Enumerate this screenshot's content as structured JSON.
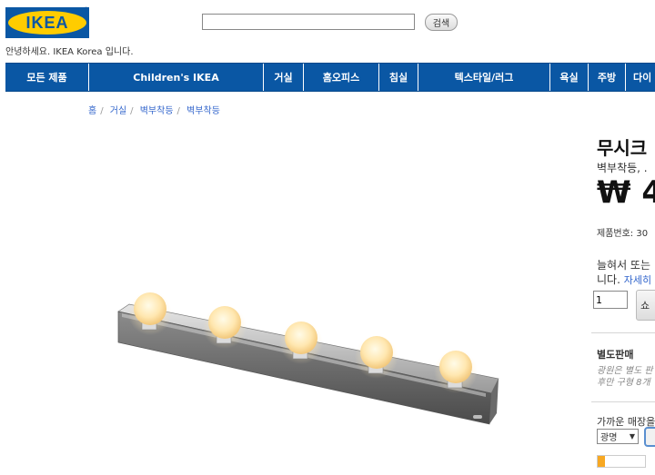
{
  "logo": {
    "text": "IKEA",
    "reg": "®"
  },
  "search": {
    "placeholder": "",
    "button_label": "검색"
  },
  "greeting": "안녕하세요. IKEA Korea 입니다.",
  "nav": {
    "items": [
      {
        "label": "모든 제품"
      },
      {
        "label": "Children's IKEA"
      },
      {
        "label": "거실"
      },
      {
        "label": "홈오피스"
      },
      {
        "label": "침실"
      },
      {
        "label": "텍스타일/러그"
      },
      {
        "label": "욕실"
      },
      {
        "label": "주방"
      },
      {
        "label": "다이"
      }
    ]
  },
  "breadcrumb": {
    "items": [
      "홈",
      "거실",
      "벽부착등",
      "벽부착등"
    ]
  },
  "product": {
    "title": "무시크",
    "subtitle": "벽부착등, .",
    "price": "₩ 4",
    "article_no": "제품번호: 30",
    "desc_line1": "늘혀서 또는",
    "desc_line2": "니다.",
    "more_link": "자세히",
    "quantity": "1",
    "buy_label": "쇼"
  },
  "separate_sale": {
    "title": "별도판매",
    "note_line1": "광원은 별도 판",
    "note_line2": "후만 구형 8개"
  },
  "store": {
    "title": "가까운 매장을",
    "selected": "광명",
    "arrow": "▼",
    "stock_level": 0.15
  },
  "colors": {
    "brand_blue": "#0a57a4",
    "brand_yellow": "#ffcc00",
    "link": "#3366cc",
    "stock": "#f7a823"
  }
}
